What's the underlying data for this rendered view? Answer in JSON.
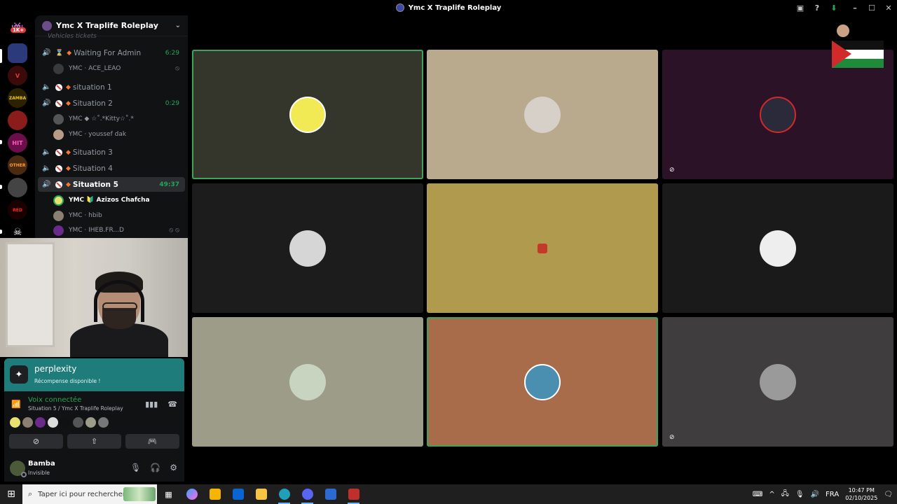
{
  "window": {
    "title": "Ymc X Traplife Roleplay",
    "controls": [
      "minimize-icon",
      "maximize-icon",
      "close-icon"
    ]
  },
  "rail": {
    "badge": "1K+"
  },
  "guild": {
    "name": "Ymc X Traplife Roleplay",
    "cut_channel": "Vehicles tickets"
  },
  "channels": [
    {
      "name": "Waiting For Admin",
      "timer": "6:29",
      "live": true
    },
    {
      "name": "situation 1",
      "timer": "",
      "live": false
    },
    {
      "name": "Situation 2",
      "timer": "0:29",
      "live": true
    },
    {
      "name": "Situation 3",
      "timer": "",
      "live": false
    },
    {
      "name": "Situation 4",
      "timer": "",
      "live": false
    },
    {
      "name": "Situation 5",
      "timer": "49:37",
      "live": true,
      "active": true
    }
  ],
  "members": {
    "waiting": [
      {
        "name": "YMC · ACE_LEAO"
      }
    ],
    "situation2": [
      {
        "name": "YMC ◆ ☆˚.*Kitty☆˚.*"
      },
      {
        "name": "YMC · youssef dak"
      }
    ],
    "situation5": [
      {
        "name": "YMC 🔰 Azizos Chafcha"
      },
      {
        "name": "YMC · hbib"
      },
      {
        "name": "YMC · IHEB.FR...D"
      }
    ]
  },
  "promo": {
    "title": "perplexity",
    "subtitle": "Récompense disponible !"
  },
  "voice": {
    "status": "Voix connectée",
    "location": "Situation 5 / Ymc X Traplife Roleplay"
  },
  "user": {
    "name": "Bamba",
    "status": "Invisible"
  },
  "colors": {
    "accent_green": "#23a55a",
    "promo_teal": "#1e7c7a",
    "tile_1": "#35362b",
    "tile_2": "#b9a98d",
    "tile_3": "#2c1226",
    "tile_4": "#1c1c1c",
    "tile_5": "#b09a4e",
    "tile_6": "#1a1a1a",
    "tile_7": "#9c9c88",
    "tile_8": "#a86c4a",
    "tile_9": "#3f3d3d"
  },
  "taskbar": {
    "search_placeholder": "Taper ici pour rechercher",
    "language": "FRA",
    "time": "10:47 PM",
    "date": "02/10/2025"
  }
}
